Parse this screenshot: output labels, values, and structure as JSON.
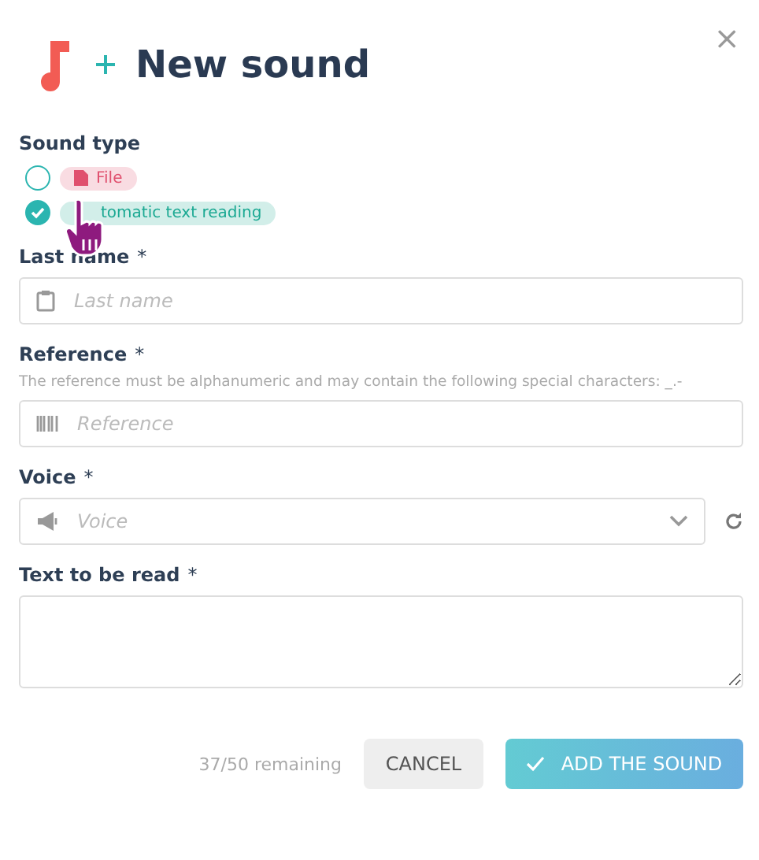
{
  "dialog": {
    "title": "New sound",
    "close": "×"
  },
  "sound_type": {
    "label": "Sound type",
    "options": [
      {
        "label": "File",
        "selected": false,
        "color": "#e0506e"
      },
      {
        "label": "tomatic text reading",
        "selected": true,
        "color": "#1ca993"
      }
    ]
  },
  "fields": [
    {
      "kind": "text",
      "label": "Last name",
      "required_mark": "*",
      "placeholder": "Last name"
    },
    {
      "kind": "text",
      "label": "Reference",
      "required_mark": "*",
      "hint": "The reference must be alphanumeric and may contain the following special characters: _.-",
      "placeholder": "Reference"
    },
    {
      "kind": "select",
      "label": "Voice",
      "required_mark": "*",
      "placeholder": "Voice"
    },
    {
      "kind": "textarea",
      "label": "Text to be read",
      "required_mark": "*"
    }
  ],
  "footer": {
    "counter": "37/50 remaining",
    "cancel": "CANCEL",
    "submit": "ADD THE SOUND"
  }
}
